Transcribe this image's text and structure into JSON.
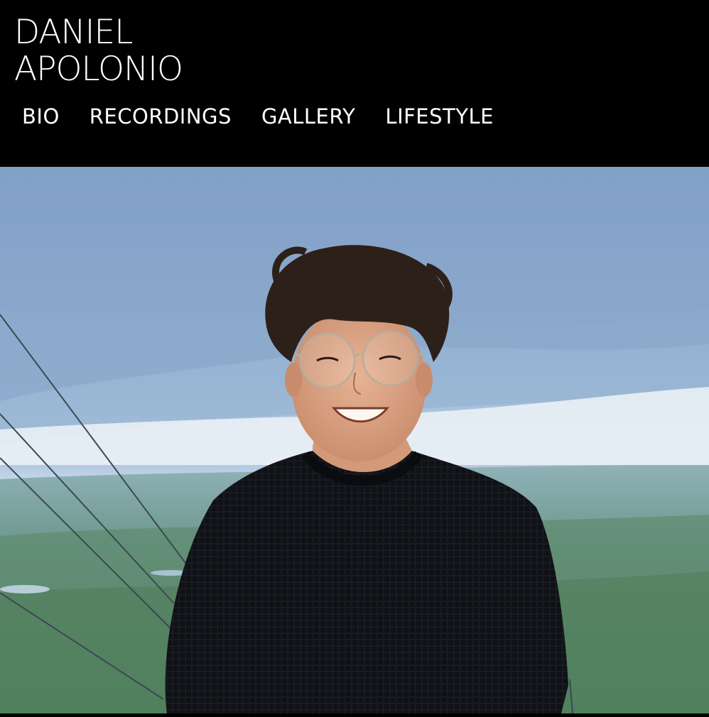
{
  "site": {
    "name_line1": "DANIEL",
    "name_line2": "APOLONIO"
  },
  "nav": {
    "items": [
      {
        "label": "BIO"
      },
      {
        "label": "RECORDINGS"
      },
      {
        "label": "GALLERY"
      },
      {
        "label": "LIFESTYLE"
      }
    ]
  },
  "hero": {
    "image_icon": "portrait-photo"
  },
  "colors": {
    "header_bg": "#000000",
    "nav_text": "#ffffff",
    "sky_top": "#7f9fc7",
    "sky_mid": "#a9c3de",
    "horizon": "#e6eef4",
    "forest": "#5f8a78",
    "sweater": "#15181d"
  }
}
